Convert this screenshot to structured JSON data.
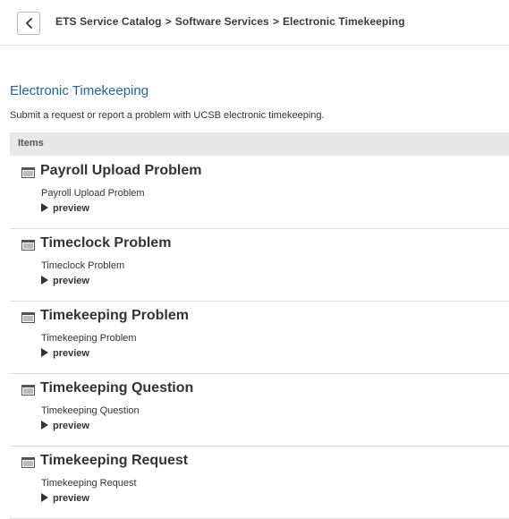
{
  "header": {
    "back_icon": "chevron-left-icon",
    "breadcrumb": [
      "ETS Service Catalog",
      "Software Services",
      "Electronic Timekeeping"
    ],
    "separator": ">"
  },
  "category": {
    "title": "Electronic Timekeeping",
    "description": "Submit a request or report a problem with UCSB electronic timekeeping."
  },
  "items_header": "Items",
  "items": [
    {
      "title": "Payroll Upload Problem",
      "subtitle": "Payroll Upload Problem",
      "preview": "preview",
      "icon": "form-icon"
    },
    {
      "title": "Timeclock Problem",
      "subtitle": "Timeclock Problem",
      "preview": "preview",
      "icon": "form-icon"
    },
    {
      "title": "Timekeeping Problem",
      "subtitle": "Timekeeping Problem",
      "preview": "preview",
      "icon": "form-icon"
    },
    {
      "title": "Timekeeping Question",
      "subtitle": "Timekeeping Question",
      "preview": "preview",
      "icon": "form-icon"
    },
    {
      "title": "Timekeeping Request",
      "subtitle": "Timekeeping Request",
      "preview": "preview",
      "icon": "form-icon"
    }
  ],
  "colors": {
    "link_blue": "#21669e",
    "header_gray": "#e8e8e8"
  }
}
